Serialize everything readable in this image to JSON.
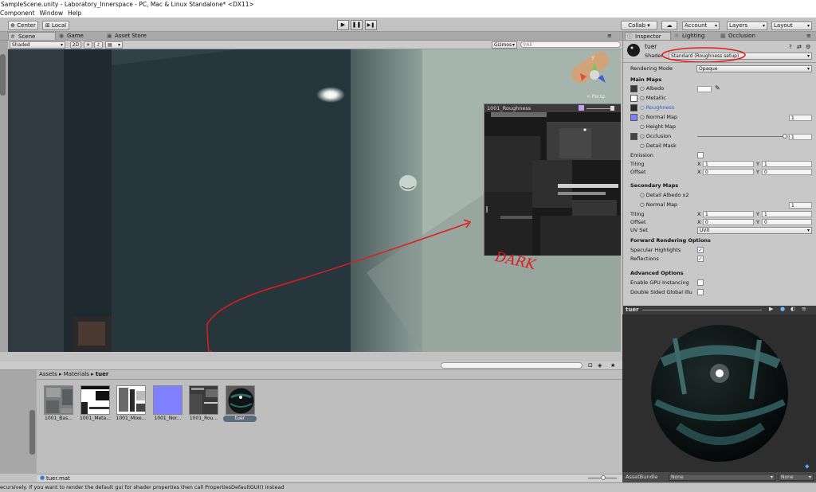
{
  "window": {
    "title": "SampleScene.unity - Laboratory_Innerspace - PC, Mac & Linux Standalone* <DX11>"
  },
  "menu": [
    "Component",
    "Window",
    "Help"
  ],
  "toolbar": {
    "center": "Center",
    "local": "Local",
    "play": "▶",
    "pause": "❚❚",
    "step": "▶❚",
    "collab": "Collab ▾",
    "cloud": "☁",
    "account": "Account",
    "layers": "Layers",
    "layout": "Layout"
  },
  "scene_tabs": [
    "Scene",
    "Game",
    "Asset Store"
  ],
  "scene_bar": {
    "shading": "Shaded",
    "mode2d": "2D",
    "gizmos": "Gizmos",
    "search_placeholder": "All"
  },
  "scene_view": {
    "persp": "< Persp"
  },
  "float_window": {
    "title": "1001_Roughness"
  },
  "annotation": {
    "text": "DARK",
    "color": "#e01c1c"
  },
  "inspector_tabs": [
    "Inspector",
    "Lighting",
    "Occlusion"
  ],
  "inspector": {
    "name": "tuer",
    "shader_label": "Shader",
    "shader_value": "Standard (Roughness setup)",
    "rendering_mode_label": "Rendering Mode",
    "rendering_mode_value": "Opaque",
    "main_maps": "Main Maps",
    "albedo": "Albedo",
    "metallic": "Metallic",
    "roughness": "Roughness",
    "normal_map": "Normal Map",
    "normal_value": "1",
    "height_map": "Height Map",
    "occlusion": "Occlusion",
    "occlusion_value": "1",
    "detail_mask": "Detail Mask",
    "emission": "Emission",
    "tiling": "Tiling",
    "offset": "Offset",
    "x": "X",
    "y": "Y",
    "one": "1",
    "zero": "0",
    "secondary_maps": "Secondary Maps",
    "detail_albedo": "Detail Albedo x2",
    "normal_map2": "Normal Map",
    "normal_value2": "1",
    "tiling2": "Tiling",
    "offset2": "Offset",
    "uv_set": "UV Set",
    "uv_value": "UV0",
    "forward": "Forward Rendering Options",
    "specular": "Specular Highlights",
    "reflections": "Reflections",
    "advanced": "Advanced Options",
    "gpu_instancing": "Enable GPU Instancing",
    "double_sided": "Double Sided Global Illu"
  },
  "preview": {
    "title": "tuer",
    "assetbundle_label": "AssetBundle",
    "assetbundle_value": "None",
    "variant_value": "None"
  },
  "project": {
    "breadcrumb": [
      "Assets",
      "Materials",
      "tuer"
    ],
    "assets": [
      {
        "label": "1001_Bas..."
      },
      {
        "label": "1001_Meta..."
      },
      {
        "label": "1001_Mixe..."
      },
      {
        "label": "1001_Nor..."
      },
      {
        "label": "1001_Rou..."
      },
      {
        "label": "tuer"
      }
    ],
    "selected_file": "tuer.mat"
  },
  "status": {
    "text": "ecursively. If you want to render the default gui for shader properties then call PropertiesDefaultGUI() instead"
  }
}
